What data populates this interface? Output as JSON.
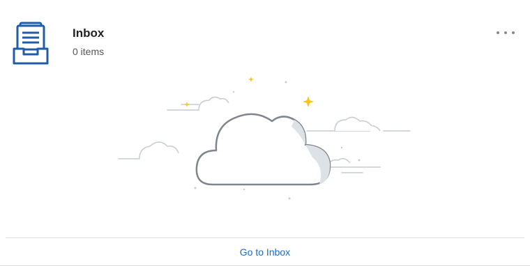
{
  "header": {
    "title": "Inbox",
    "count_text": "0 items",
    "more_icon": "more-horizontal-icon",
    "inbox_icon": "inbox-tray-icon"
  },
  "illustration": {
    "icon": "cloud-empty-state-icon"
  },
  "footer": {
    "link_label": "Go to Inbox"
  },
  "colors": {
    "accent": "#1a6bc6",
    "icon_blue": "#1f5da8",
    "sparkle": "#f5c518"
  }
}
